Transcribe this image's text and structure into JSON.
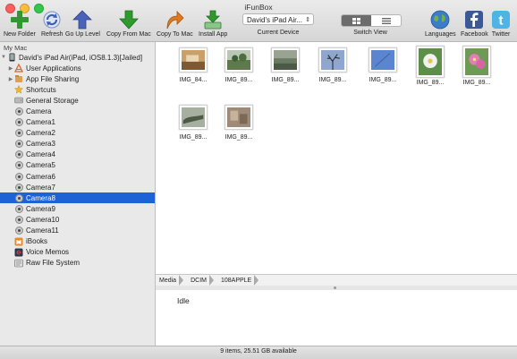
{
  "window": {
    "title": "iFunBox"
  },
  "toolbar": {
    "new_folder": "New Folder",
    "refresh": "Refresh",
    "go_up": "Go Up Level",
    "copy_from_mac": "Copy From Mac",
    "copy_to_mac": "Copy To Mac",
    "install_app": "Install App",
    "current_device_value": "David's iPad Air...",
    "current_device_label": "Current Device",
    "switch_view_label": "Switch View",
    "languages": "Languages",
    "facebook": "Facebook",
    "twitter": "Twitter"
  },
  "sidebar": {
    "header": "My Mac",
    "device": "David's iPad Air(iPad, iOS8.1.3)[Jailed]",
    "items": [
      {
        "label": "User Applications",
        "icon": "apps-icon"
      },
      {
        "label": "App File Sharing",
        "icon": "file-sharing-icon"
      },
      {
        "label": "Shortcuts",
        "icon": "star-icon"
      },
      {
        "label": "General Storage",
        "icon": "storage-icon"
      },
      {
        "label": "Camera",
        "icon": "camera-icon"
      },
      {
        "label": "Camera1",
        "icon": "camera-icon"
      },
      {
        "label": "Camera2",
        "icon": "camera-icon"
      },
      {
        "label": "Camera3",
        "icon": "camera-icon"
      },
      {
        "label": "Camera4",
        "icon": "camera-icon"
      },
      {
        "label": "Camera5",
        "icon": "camera-icon"
      },
      {
        "label": "Camera6",
        "icon": "camera-icon"
      },
      {
        "label": "Camera7",
        "icon": "camera-icon"
      },
      {
        "label": "Camera8",
        "icon": "camera-icon",
        "selected": true
      },
      {
        "label": "Camera9",
        "icon": "camera-icon"
      },
      {
        "label": "Camera10",
        "icon": "camera-icon"
      },
      {
        "label": "Camera11",
        "icon": "camera-icon"
      },
      {
        "label": "iBooks",
        "icon": "ibooks-icon"
      },
      {
        "label": "Voice Memos",
        "icon": "voice-memos-icon"
      },
      {
        "label": "Raw File System",
        "icon": "raw-fs-icon"
      }
    ]
  },
  "files": [
    {
      "name": "IMG_84..."
    },
    {
      "name": "IMG_89..."
    },
    {
      "name": "IMG_89..."
    },
    {
      "name": "IMG_89..."
    },
    {
      "name": "IMG_89..."
    },
    {
      "name": "IMG_89..."
    },
    {
      "name": "IMG_89..."
    },
    {
      "name": "IMG_89..."
    },
    {
      "name": "IMG_89..."
    }
  ],
  "path": [
    "Media",
    "DCIM",
    "108APPLE"
  ],
  "log": {
    "text": "Idle"
  },
  "status": {
    "text": "9 items, 25.51 GB available"
  },
  "colors": {
    "selection": "#1d63d6",
    "toolbar_green": "#2e9a2e",
    "toolbar_blue": "#3b5fb0"
  }
}
